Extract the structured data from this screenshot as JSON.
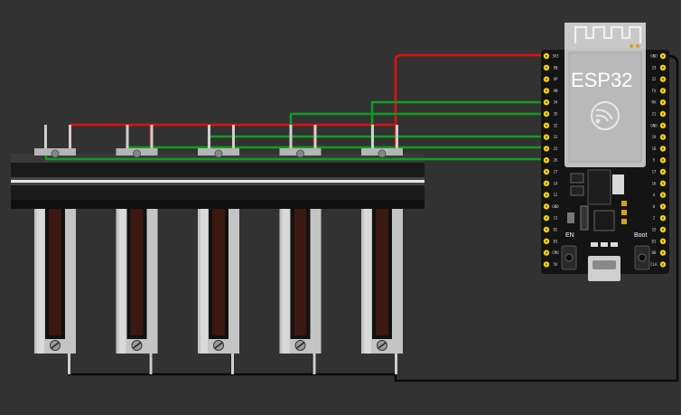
{
  "board": {
    "name": "ESP32",
    "buttons": {
      "left": "EN",
      "right": "Boot"
    },
    "left_pins": [
      "3V3",
      "EN",
      "VP",
      "VN",
      "34",
      "35",
      "32",
      "33",
      "25",
      "26",
      "27",
      "14",
      "12",
      "GND",
      "13",
      "D2",
      "D3",
      "CMD",
      "5V"
    ],
    "right_pins": [
      "GND",
      "23",
      "22",
      "TX",
      "RX",
      "21",
      "GND",
      "19",
      "18",
      "5",
      "17",
      "16",
      "4",
      "0",
      "2",
      "15",
      "D1",
      "D0",
      "CLK"
    ]
  },
  "sliders": {
    "count": 5
  },
  "colors": {
    "background": "#323232",
    "wire_power": "#e01010",
    "wire_signal": "#0f9e1e",
    "wire_ground": "#0a0a0a",
    "board": "#141414",
    "module": "#c9c9c9"
  }
}
